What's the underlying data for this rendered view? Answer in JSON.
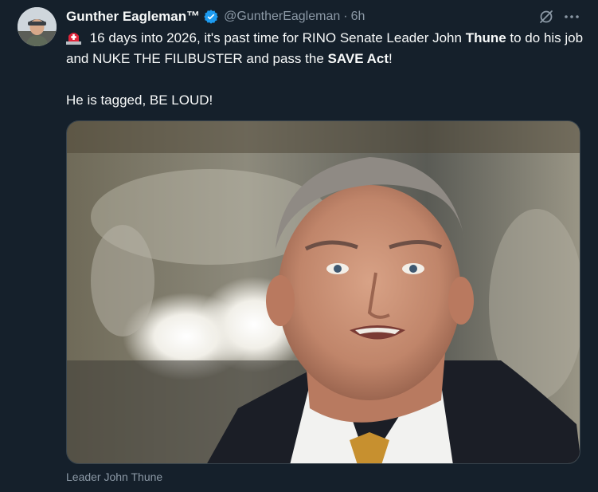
{
  "author": {
    "display_name": "Gunther Eagleman™",
    "handle": "@GuntherEagleman",
    "separator": "·",
    "time": "6h",
    "verified": true
  },
  "tweet": {
    "line1_a": " 16 days into 2026, it's past time for RINO Senate Leader John ",
    "line1_b": "Thune",
    "line1_c": " to do his job and NUKE THE FILIBUSTER and pass the ",
    "line1_d": "SAVE Act",
    "line1_e": "!",
    "line2": "He is tagged,  BE LOUD!"
  },
  "media": {
    "caption": "Leader John Thune"
  },
  "icons": {
    "verified": "verified-badge-icon",
    "grok": "grok-icon",
    "more": "more-horizontal-icon",
    "siren": "rotating-light-emoji-icon"
  },
  "colors": {
    "background": "#15202b",
    "text_primary": "#f7f9f9",
    "text_secondary": "#8b98a5",
    "verified_blue": "#1d9bf0",
    "border": "#38444d"
  }
}
